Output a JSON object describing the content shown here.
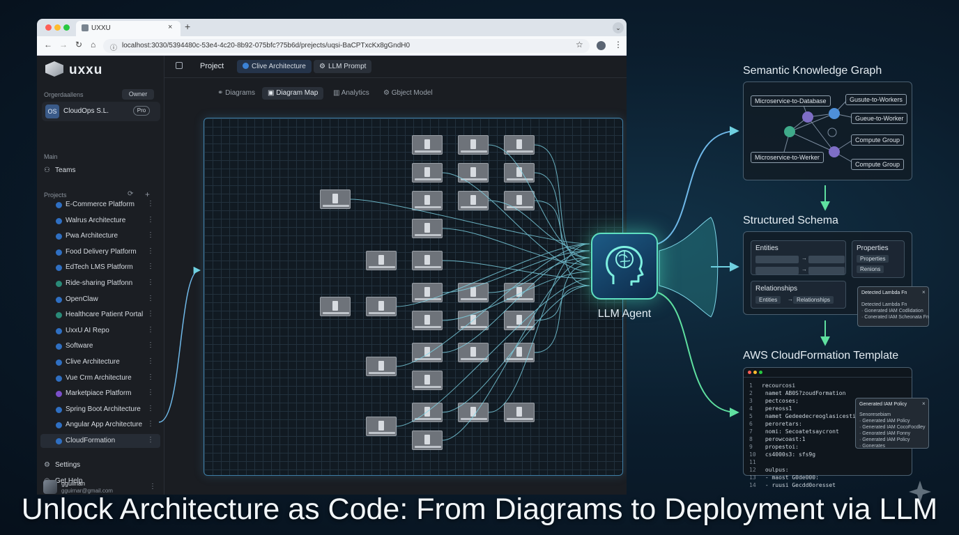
{
  "browser": {
    "tab_title": "UXXU",
    "new_tab": "+",
    "close": "×",
    "url": "localhost:3030/5394480c-53e4-4c20-8b92-075bfc?75b6d/prejects/uqsi-BaCPTxcKx8gGndH0"
  },
  "sidebar": {
    "logo": "uxxu",
    "org_label": "Orgerdaallens",
    "owner_badge": "Owner",
    "org_initials": "OS",
    "org_name": "CloudOps S.L.",
    "plan_badge": "Pro",
    "main_label": "Main",
    "teams": "Teams",
    "projects_label": "Projects",
    "projects": [
      {
        "label": "E-Commerce Platform",
        "color": "#2f6fc2"
      },
      {
        "label": "Walrus Architecture",
        "color": "#2f6fc2"
      },
      {
        "label": "Pwa Architecture",
        "color": "#2f6fc2"
      },
      {
        "label": "Food Delivery Platform",
        "color": "#2f6fc2"
      },
      {
        "label": "EdTech LMS Platform",
        "color": "#2f6fc2"
      },
      {
        "label": "Ride-sharing Platfonn",
        "color": "#2a8a78"
      },
      {
        "label": "OpenClaw",
        "color": "#2f6fc2"
      },
      {
        "label": "Healthcare Patient Portal",
        "color": "#2a8a78"
      },
      {
        "label": "UxxU AI Repo",
        "color": "#2f6fc2"
      },
      {
        "label": "Software",
        "color": "#2f6fc2"
      },
      {
        "label": "Clive Architecture",
        "color": "#2f6fc2"
      },
      {
        "label": "Vue Crm Architecture",
        "color": "#2f6fc2"
      },
      {
        "label": "Marketpiace Platform",
        "color": "#7b4fc9"
      },
      {
        "label": "Spring Boot Architecture",
        "color": "#2f6fc2"
      },
      {
        "label": "Angular App Architecture",
        "color": "#2f6fc2"
      },
      {
        "label": "CloudFormation",
        "color": "#2f6fc2"
      }
    ],
    "settings": "Settings",
    "help": "Get Help",
    "user_name": "gguiinan",
    "user_email": "gguirnar@gmail.com"
  },
  "topbar": {
    "project": "Project",
    "active_chip": "Clive Architecture",
    "prompt_chip": "LLM Prompt"
  },
  "view_tabs": [
    "Diagrams",
    "Diagram Map",
    "Analytics",
    "Gbject Model"
  ],
  "llm_agent": "LLM Agent",
  "knowledge_graph": {
    "title": "Semantic Knowledge Graph",
    "labels": [
      "Microservice-to-Database",
      "Gusute-to-Workers",
      "Gueue-to-Worker",
      "Compute Group",
      "Microservice-to-Werker",
      "Compute Group"
    ]
  },
  "schema": {
    "title": "Structured Schema",
    "entities": "Entities",
    "properties": "Properties",
    "properties_items": [
      "Properties",
      "Renions"
    ],
    "relationships": "Relationships",
    "rel_from": "Entities",
    "rel_to": "Relationships",
    "popup_title": "Detected Lambda Fn",
    "popup_lines": [
      "Detected Lambda Fn",
      "· Gonerated IAM Codlidation",
      "· Conerated IAM Scheonata Fn"
    ]
  },
  "cloudformation": {
    "title": "AWS CloudFormation Template",
    "code": [
      {
        "n": "1",
        "t": "recourcosi"
      },
      {
        "n": "2",
        "t": "  namet AB0S?zoudFormation"
      },
      {
        "n": "3",
        "t": "  pectcoses;"
      },
      {
        "n": "4",
        "t": "    pereoss1"
      },
      {
        "n": "5",
        "t": "    namet Gedeedecreoglasicestipt"
      },
      {
        "n": "6",
        "t": "  peroretars:"
      },
      {
        "n": "7",
        "t": "    nomi: Secoatetsaycront"
      },
      {
        "n": "8",
        "t": "  perowcoast:1"
      },
      {
        "n": "9",
        "t": "    propestoi:"
      },
      {
        "n": "10",
        "t": "      cs4000s3: sfs9g"
      },
      {
        "n": "11",
        "t": ""
      },
      {
        "n": "12",
        "t": "  oulpus:"
      },
      {
        "n": "13",
        "t": "    - maost G0de000:"
      },
      {
        "n": "14",
        "t": "    - ruusi Gecdd0oresset"
      }
    ],
    "popup_title": "Generated IAM Policy",
    "popup_lines": [
      "Senoresebiam",
      "· Generated IAM Policy",
      "· Generated IAM CocoFocdley",
      "· Genorated IAM Fonny",
      "· Generated IAM Policy",
      "· Gonerates"
    ]
  },
  "headline": "Unlock Architecture as Code: From Diagrams to Deployment via LLM"
}
